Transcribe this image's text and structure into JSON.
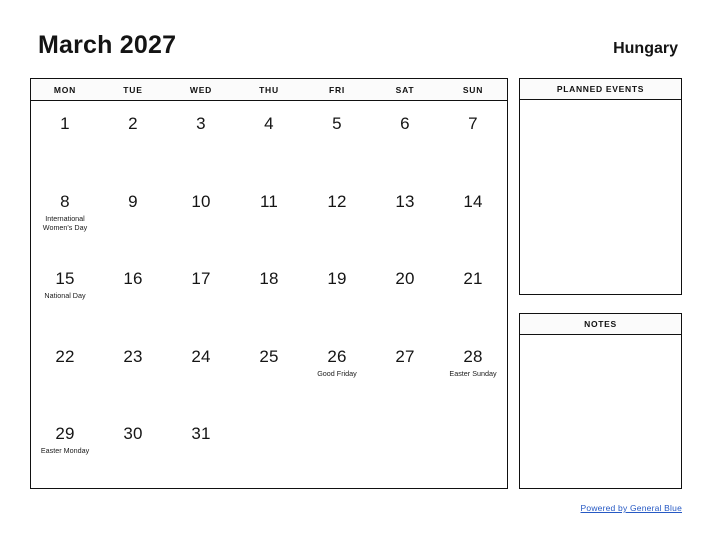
{
  "header": {
    "month_title": "March 2027",
    "country": "Hungary"
  },
  "calendar": {
    "weekdays": [
      "MON",
      "TUE",
      "WED",
      "THU",
      "FRI",
      "SAT",
      "SUN"
    ],
    "weeks": [
      [
        {
          "day": "1",
          "event": ""
        },
        {
          "day": "2",
          "event": ""
        },
        {
          "day": "3",
          "event": ""
        },
        {
          "day": "4",
          "event": ""
        },
        {
          "day": "5",
          "event": ""
        },
        {
          "day": "6",
          "event": ""
        },
        {
          "day": "7",
          "event": ""
        }
      ],
      [
        {
          "day": "8",
          "event": "International\nWomen's Day"
        },
        {
          "day": "9",
          "event": ""
        },
        {
          "day": "10",
          "event": ""
        },
        {
          "day": "11",
          "event": ""
        },
        {
          "day": "12",
          "event": ""
        },
        {
          "day": "13",
          "event": ""
        },
        {
          "day": "14",
          "event": ""
        }
      ],
      [
        {
          "day": "15",
          "event": "National Day"
        },
        {
          "day": "16",
          "event": ""
        },
        {
          "day": "17",
          "event": ""
        },
        {
          "day": "18",
          "event": ""
        },
        {
          "day": "19",
          "event": ""
        },
        {
          "day": "20",
          "event": ""
        },
        {
          "day": "21",
          "event": ""
        }
      ],
      [
        {
          "day": "22",
          "event": ""
        },
        {
          "day": "23",
          "event": ""
        },
        {
          "day": "24",
          "event": ""
        },
        {
          "day": "25",
          "event": ""
        },
        {
          "day": "26",
          "event": "Good Friday"
        },
        {
          "day": "27",
          "event": ""
        },
        {
          "day": "28",
          "event": "Easter Sunday"
        }
      ],
      [
        {
          "day": "29",
          "event": "Easter Monday"
        },
        {
          "day": "30",
          "event": ""
        },
        {
          "day": "31",
          "event": ""
        },
        {
          "day": "",
          "event": ""
        },
        {
          "day": "",
          "event": ""
        },
        {
          "day": "",
          "event": ""
        },
        {
          "day": "",
          "event": ""
        }
      ]
    ]
  },
  "panels": {
    "planned_events_title": "PLANNED EVENTS",
    "notes_title": "NOTES"
  },
  "footer": {
    "link_text": "Powered by General Blue"
  },
  "colors": {
    "link": "#2659c4",
    "border": "#111111",
    "text": "#151515",
    "header_background": "#fbfbfb"
  }
}
